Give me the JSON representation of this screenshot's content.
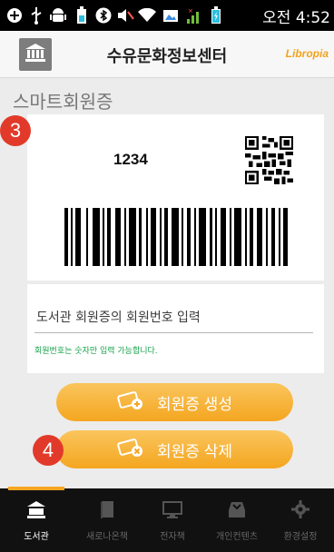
{
  "status_bar": {
    "time": "오전 4:52",
    "icons": [
      "add-circle-icon",
      "usb-icon",
      "android-icon",
      "battery-small-icon",
      "bluetooth-icon",
      "mute-icon",
      "wifi-icon",
      "image-icon",
      "signal-icon",
      "battery-icon"
    ]
  },
  "header": {
    "home_icon": "library-building-icon",
    "title": "수유문화정보센터",
    "brand": "Libropia"
  },
  "page": {
    "title": "스마트회원증"
  },
  "member_card": {
    "number": "1234",
    "qr_icon": "qr-code-icon",
    "barcode_icon": "barcode-icon"
  },
  "member_input": {
    "placeholder": "도서관 회원증의 회원번호 입력",
    "value": "",
    "hint": "회원번호는 숫자만 입력 가능합니다."
  },
  "buttons": {
    "create_label": "회원증 생성",
    "delete_label": "회원증 삭제"
  },
  "badges": {
    "step3": "3",
    "step4": "4"
  },
  "colors": {
    "accent": "#f4a620",
    "badge": "#e23a2a",
    "hint": "#17a34a",
    "nav_bg": "#111111"
  },
  "bottom_nav": {
    "items": [
      {
        "label": "도서관",
        "icon": "library-icon",
        "active": true
      },
      {
        "label": "새로나온책",
        "icon": "book-icon",
        "active": false
      },
      {
        "label": "전자책",
        "icon": "monitor-icon",
        "active": false
      },
      {
        "label": "개인컨텐츠",
        "icon": "tray-icon",
        "active": false
      },
      {
        "label": "환경설정",
        "icon": "gear-icon",
        "active": false
      }
    ]
  }
}
